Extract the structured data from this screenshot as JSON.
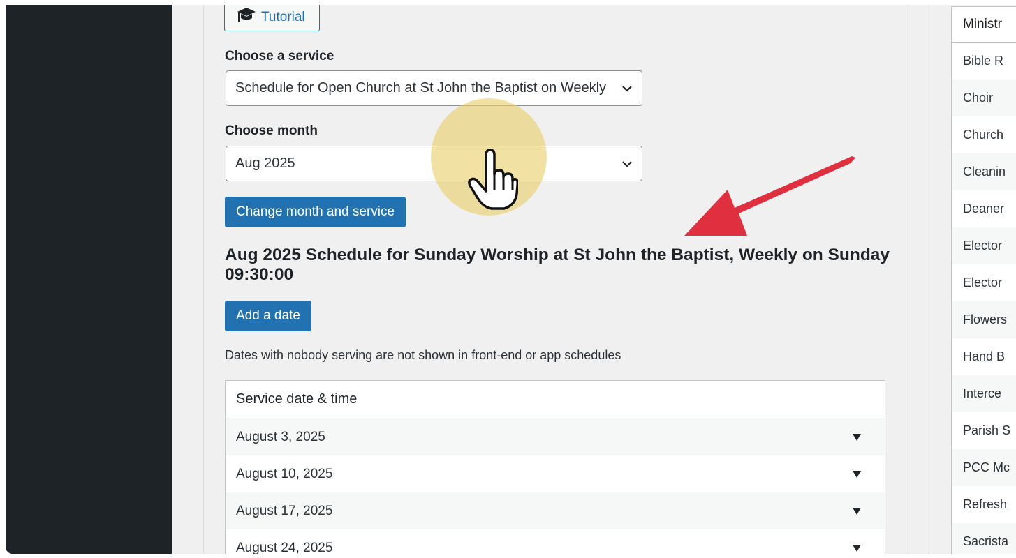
{
  "tutorial": {
    "label": "Tutorial",
    "icon": "graduation-cap-icon"
  },
  "service": {
    "label": "Choose a service",
    "value": "Schedule for Open Church at St John the Baptist on Weekly"
  },
  "month": {
    "label": "Choose month",
    "value": "Aug 2025"
  },
  "change_button": "Change month and service",
  "schedule_heading": "Aug 2025 Schedule for Sunday Worship at St John the Baptist, Weekly on Sunday 09:30:00",
  "add_date_button": "Add a date",
  "note": "Dates with nobody serving are not shown in front-end or app schedules",
  "table": {
    "header": "Service date & time",
    "rows": [
      "August 3, 2025",
      "August 10, 2025",
      "August 17, 2025",
      "August 24, 2025"
    ]
  },
  "ministries": {
    "header": "Ministr",
    "items": [
      "Bible R",
      "Choir",
      "Church",
      "Cleanin",
      "Deaner",
      "Elector",
      "Elector",
      "Flowers",
      "Hand B",
      "Interce",
      "Parish S",
      "PCC Mc",
      "Refresh",
      "Sacrista"
    ]
  },
  "colors": {
    "accent": "#2271b1",
    "sidebar": "#1d2327",
    "arrow": "#e0303f",
    "cursor_halo": "#e8ce68"
  }
}
